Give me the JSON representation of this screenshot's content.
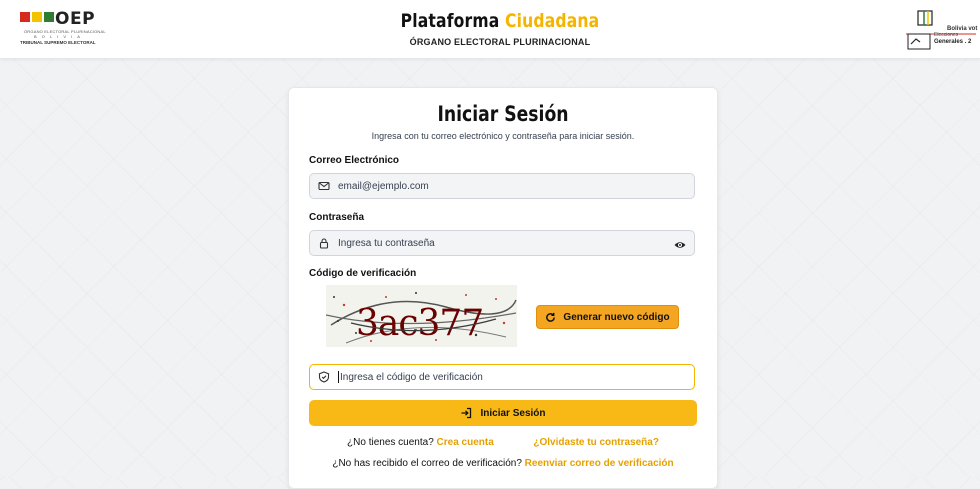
{
  "header": {
    "logo": {
      "text": "OEP",
      "subtitle_line1": "ÓRGANO ELECTORAL PLURINACIONAL",
      "subtitle_line2": "B O L I V I A",
      "subtitle_line3": "TRIBUNAL SUPREMO ELECTORAL",
      "colors": [
        "#d52b1e",
        "#f4c300",
        "#2e7d32",
        "#000000"
      ]
    },
    "title_part1": "Plataforma",
    "title_part2": "Ciudadana",
    "subtitle": "ÓRGANO ELECTORAL PLURINACIONAL",
    "right_logo": {
      "line1": "Bolivia vot",
      "line2": "Elecciones",
      "line3": "Generales",
      "number": "2"
    }
  },
  "login": {
    "title": "Iniciar Sesión",
    "description": "Ingresa con tu correo electrónico y contraseña para iniciar sesión.",
    "email_label": "Correo Electrónico",
    "email_placeholder": "email@ejemplo.com",
    "password_label": "Contraseña",
    "password_placeholder": "Ingresa tu contraseña",
    "captcha_label": "Código de verificación",
    "captcha_text": "3ac377",
    "generate_button": "Generar nuevo código",
    "code_placeholder": "Ingresa el código de verificación",
    "submit_button": "Iniciar Sesión",
    "no_account_text": "¿No tienes cuenta?",
    "create_account_link": "Crea cuenta",
    "forgot_password_link": "¿Olvidaste tu contraseña?",
    "no_email_text": "¿No has recibido el correo de verificación?",
    "resend_link": "Reenviar correo de verificación"
  },
  "colors": {
    "accent": "#f4b400",
    "button": "#f8b916",
    "link": "#e6a100"
  }
}
